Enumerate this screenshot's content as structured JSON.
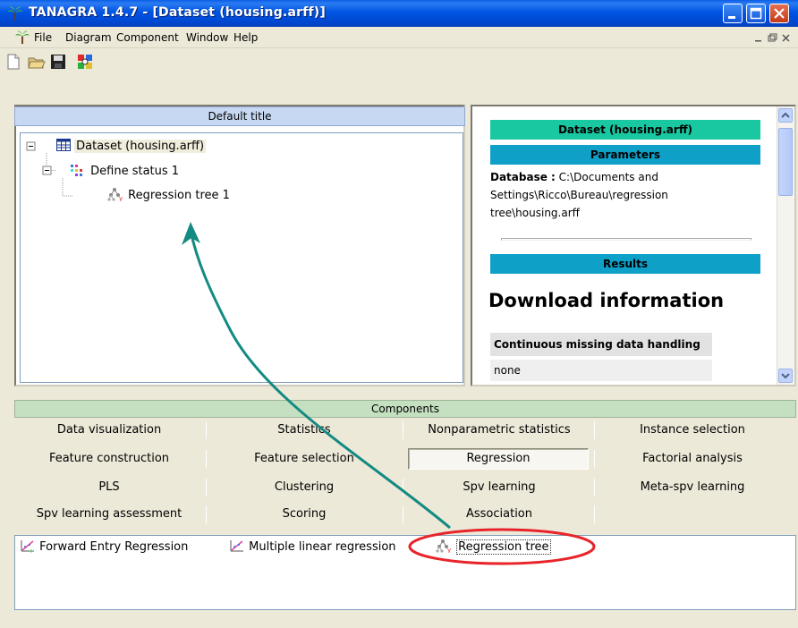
{
  "window": {
    "title": "TANAGRA 1.4.7 - [Dataset (housing.arff)]"
  },
  "menu": {
    "items": [
      "File",
      "Diagram",
      "Component",
      "Window",
      "Help"
    ]
  },
  "diagram": {
    "title": "Default title",
    "nodes": [
      {
        "label": "Dataset (housing.arff)",
        "icon": "dataset-icon"
      },
      {
        "label": "Define status 1",
        "icon": "define-status-icon"
      },
      {
        "label": "Regression tree 1",
        "icon": "regression-tree-icon"
      }
    ]
  },
  "results": {
    "header": "Dataset (housing.arff)",
    "parameters_label": "Parameters",
    "database_label": "Database :",
    "database_path_lines": [
      "C:\\Documents and",
      "Settings\\Ricco\\Bureau\\regression",
      "tree\\housing.arff"
    ],
    "results_label": "Results",
    "download_heading": "Download information",
    "table_header": "Continuous missing data handling",
    "table_value": "none",
    "colors": {
      "title_bar": "#19c7a0",
      "section_bar": "#0fa0c8"
    }
  },
  "components": {
    "header": "Components",
    "tabs": [
      [
        "Data visualization",
        "Statistics",
        "Nonparametric statistics",
        "Instance selection"
      ],
      [
        "Feature construction",
        "Feature selection",
        "Regression",
        "Factorial analysis"
      ],
      [
        "PLS",
        "Clustering",
        "Spv learning",
        "Meta-spv learning"
      ],
      [
        "Spv learning assessment",
        "Scoring",
        "Association",
        ""
      ]
    ],
    "selected_tab": "Regression",
    "items": [
      "Forward Entry Regression",
      "Multiple linear regression",
      "Regression tree"
    ]
  },
  "annotation": {
    "circle_color": "#e8242a",
    "arrow_color": "#138a82"
  }
}
